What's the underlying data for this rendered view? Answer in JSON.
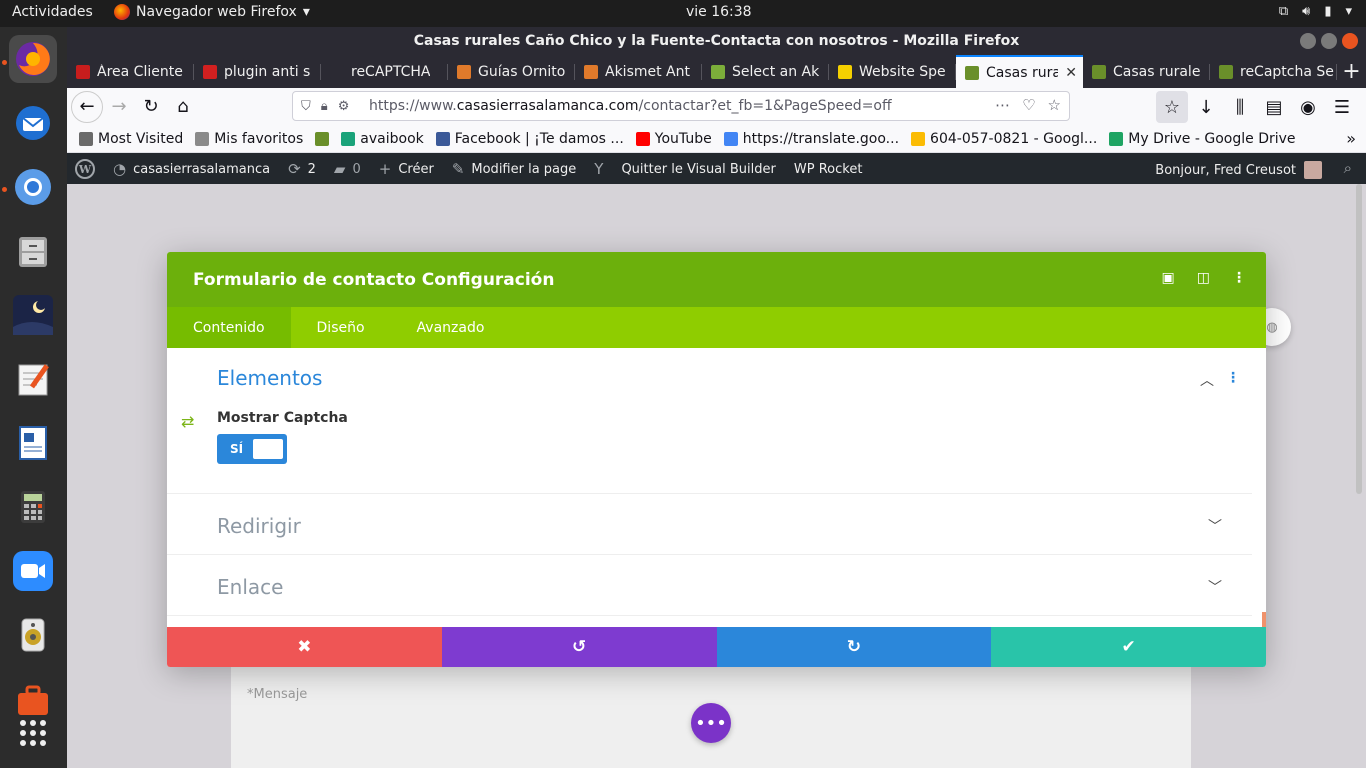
{
  "system": {
    "activities": "Actividades",
    "app_menu": "Navegador web Firefox",
    "clock": "vie 16:38"
  },
  "window": {
    "title": "Casas rurales Caño Chico y la Fuente-Contacta con nosotros - Mozilla Firefox"
  },
  "tabs": [
    {
      "label": "Área Cliente",
      "color": "#c81d1d",
      "active": false
    },
    {
      "label": "plugin anti s",
      "color": "#d22020",
      "active": false
    },
    {
      "label": "reCAPTCHA",
      "color": "#2b2a33",
      "active": false
    },
    {
      "label": "Guías Ornito",
      "color": "#e07a2b",
      "active": false
    },
    {
      "label": "Akismet Ant",
      "color": "#e07a2b",
      "active": false
    },
    {
      "label": "Select an Ak",
      "color": "#7cae3a",
      "active": false
    },
    {
      "label": "Website Spe",
      "color": "#f5d000",
      "active": false
    },
    {
      "label": "Casas rura",
      "color": "#6a8f2a",
      "active": true
    },
    {
      "label": "Casas rurale",
      "color": "#6a8f2a",
      "active": false
    },
    {
      "label": "reCaptcha Se",
      "color": "#6a8f2a",
      "active": false
    }
  ],
  "url": {
    "prefix": "https://www.",
    "host": "casasierrasalamanca.com",
    "path": "/contactar?et_fb=1&PageSpeed=off"
  },
  "bookmarks": [
    {
      "label": "Most Visited",
      "color": "#6a6a6a"
    },
    {
      "label": "Mis favoritos",
      "color": "#8a8a8a"
    },
    {
      "label": "",
      "color": "#6a8f2a"
    },
    {
      "label": "avaibook",
      "color": "#1aa37a"
    },
    {
      "label": "Facebook | ¡Te damos ...",
      "color": "#3b5998"
    },
    {
      "label": "YouTube",
      "color": "#ff0000"
    },
    {
      "label": "https://translate.goo...",
      "color": "#4285f4"
    },
    {
      "label": "604-057-0821 - Googl...",
      "color": "#fbbc04"
    },
    {
      "label": "My Drive - Google Drive",
      "color": "#1fa463"
    }
  ],
  "wpbar": {
    "site": "casasierrasalamanca",
    "updates": "2",
    "comments": "0",
    "create": "Créer",
    "edit": "Modifier la page",
    "quit_vb": "Quitter le Visual Builder",
    "rocket": "WP Rocket",
    "howdy": "Bonjour, Fred Creusot"
  },
  "modal": {
    "title": "Formulario de contacto Configuración",
    "tabs": [
      "Contenido",
      "Diseño",
      "Avanzado"
    ],
    "sections": {
      "elementos": "Elementos",
      "redirigir": "Redirigir",
      "enlace": "Enlace"
    },
    "captcha_label": "Mostrar Captcha",
    "toggle_value": "SÍ",
    "footer_colors": {
      "cancel": "#ef5555",
      "undo": "#7e3bd0",
      "redo": "#2b87da",
      "save": "#29c4a9"
    }
  },
  "page": {
    "message_placeholder": "*Mensaje"
  }
}
